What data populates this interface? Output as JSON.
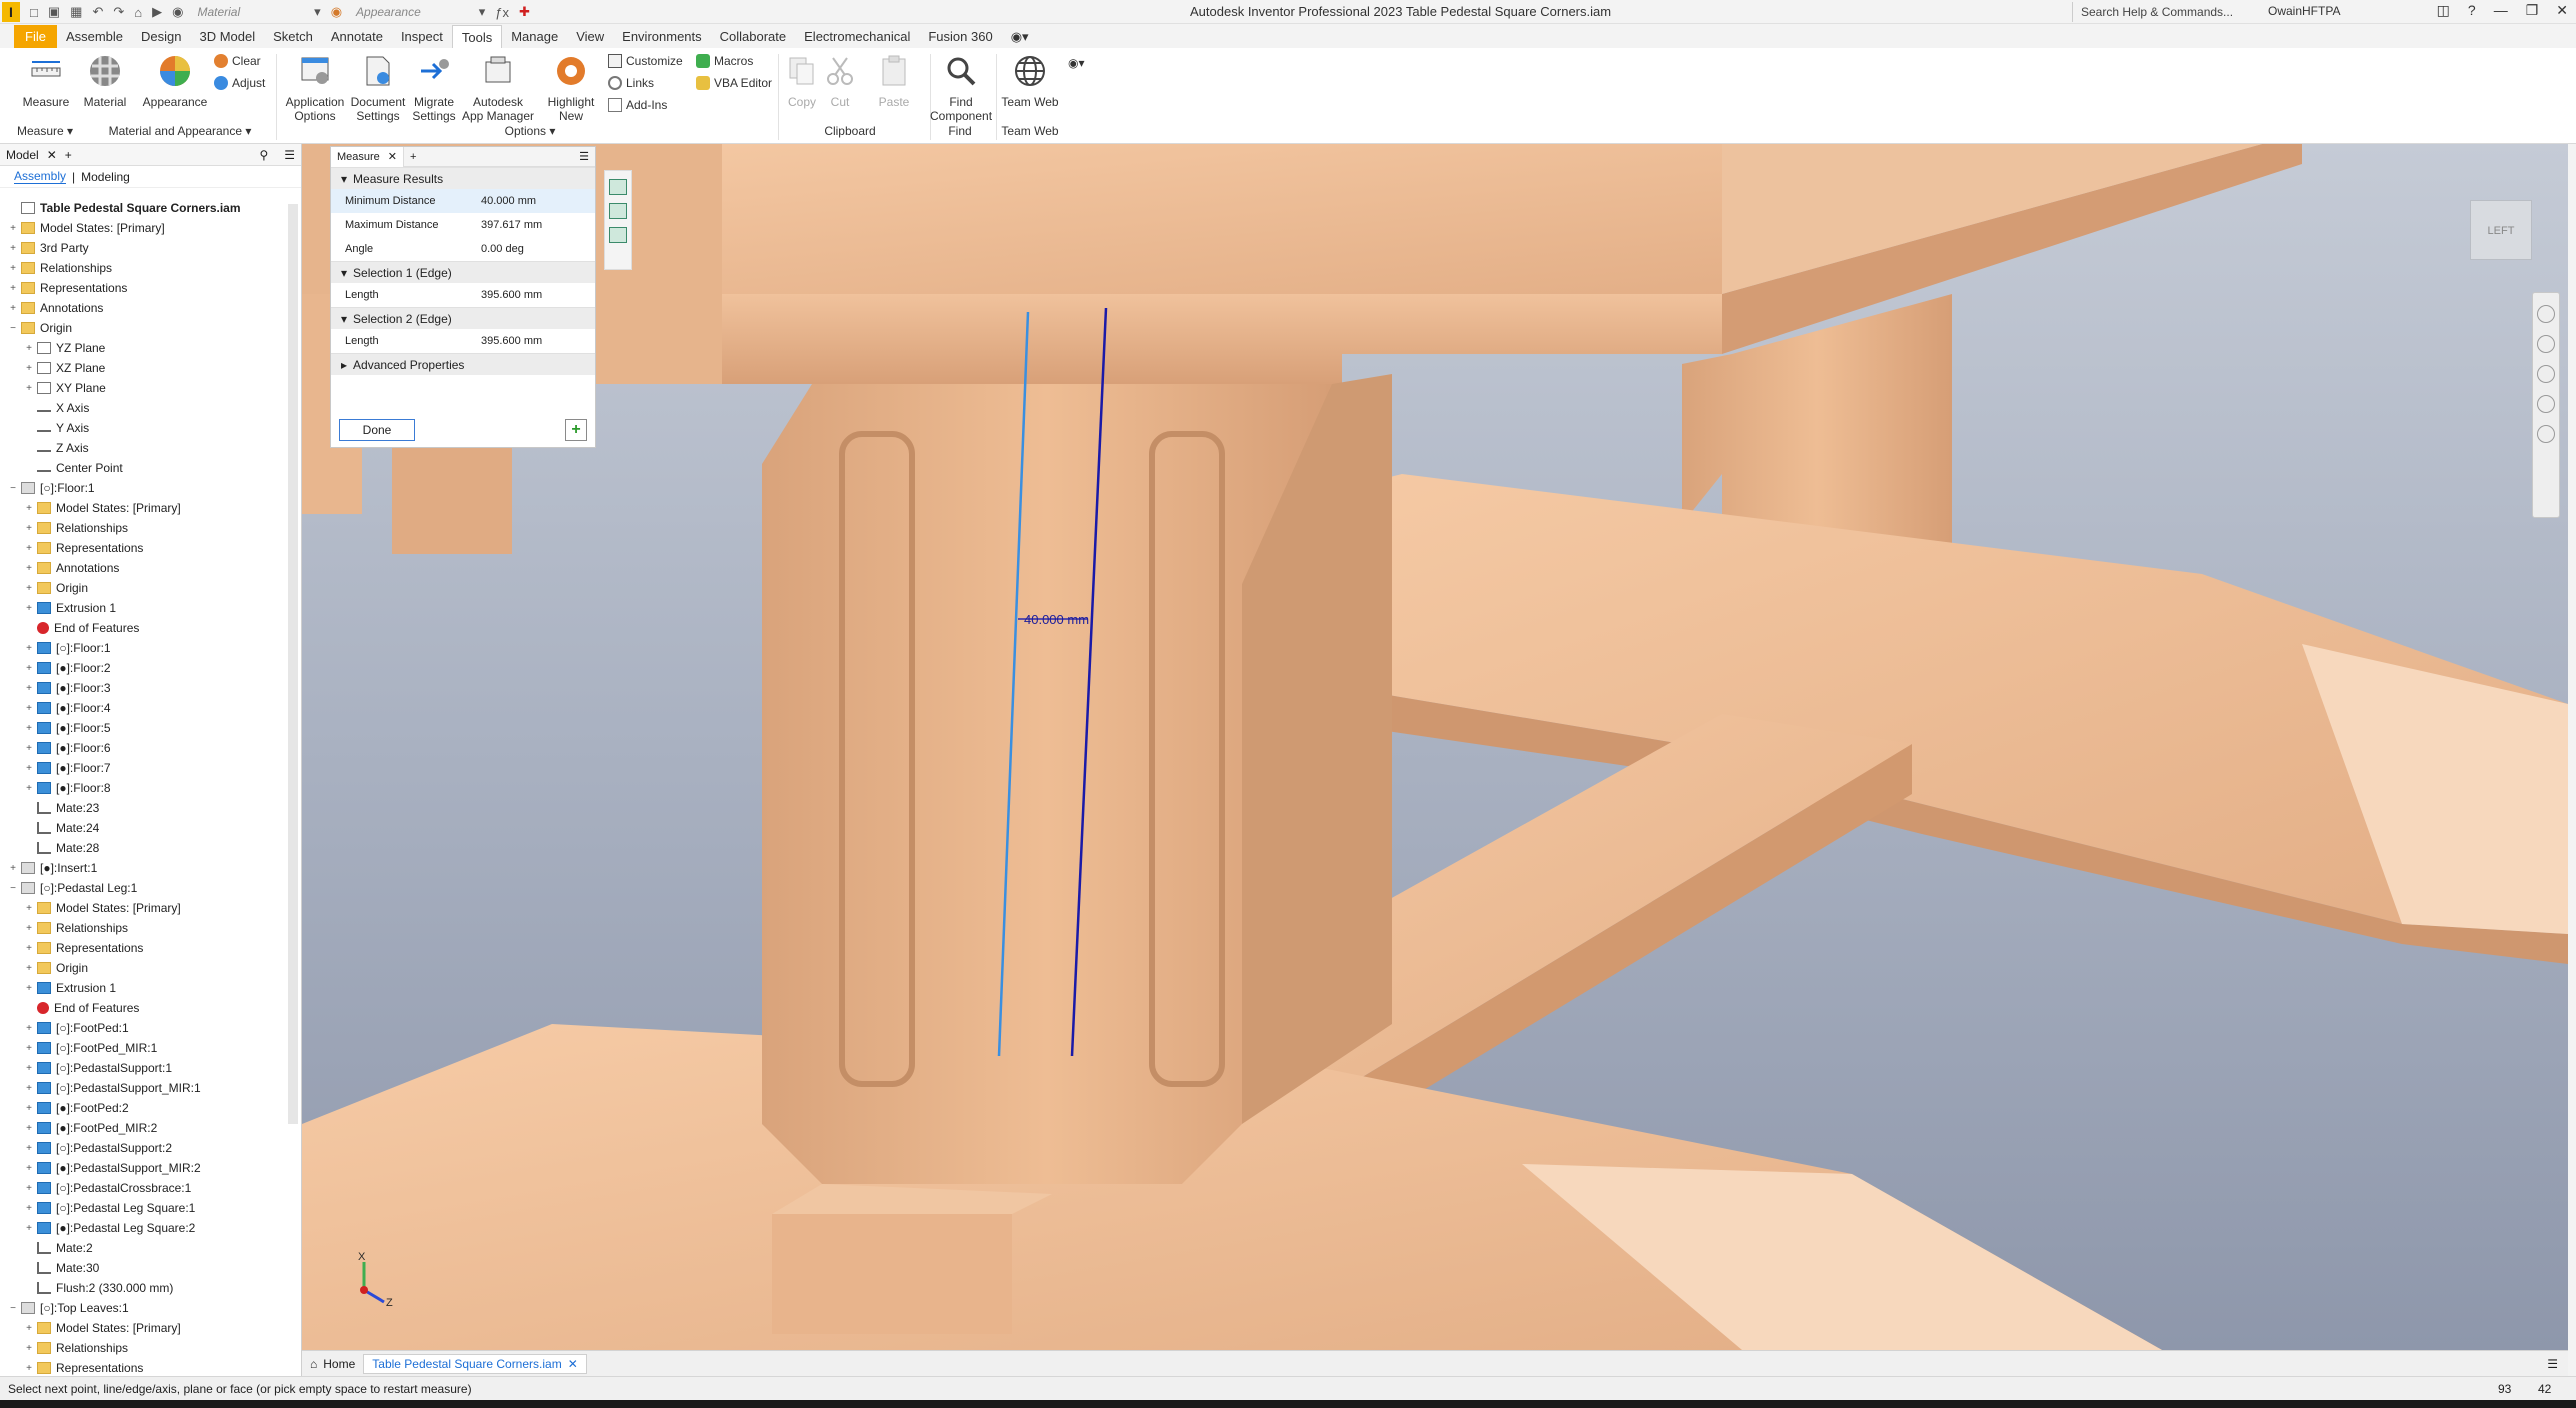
{
  "window": {
    "title": "Autodesk Inventor Professional 2023   Table Pedestal Square Corners.iam",
    "search_placeholder": "Search Help & Commands...",
    "user": "OwainHFTPA",
    "qat_material": "Material",
    "qat_appearance": "Appearance"
  },
  "menu_tabs": [
    "File",
    "Assemble",
    "Design",
    "3D Model",
    "Sketch",
    "Annotate",
    "Inspect",
    "Tools",
    "Manage",
    "View",
    "Environments",
    "Collaborate",
    "Electromechanical",
    "Fusion 360"
  ],
  "ribbon": {
    "measure": "Measure",
    "material": "Material",
    "appearance": "Appearance",
    "clear": "Clear",
    "adjust": "Adjust",
    "application_options": [
      "Application",
      "Options"
    ],
    "document_settings": [
      "Document",
      "Settings"
    ],
    "migrate_settings": [
      "Migrate",
      "Settings"
    ],
    "app_manager": [
      "Autodesk",
      "App Manager"
    ],
    "highlight_new": [
      "Highlight",
      "New"
    ],
    "customize": "Customize",
    "links": "Links",
    "add_ins": "Add-Ins",
    "macros": "Macros",
    "vba_editor": "VBA Editor",
    "copy": "Copy",
    "cut": "Cut",
    "paste": "Paste",
    "find_component": [
      "Find",
      "Component"
    ],
    "team_web": "Team Web",
    "panels": {
      "measure": "Measure ▾",
      "material_appearance": "Material and Appearance ▾",
      "options": "Options ▾",
      "clipboard": "Clipboard",
      "find": "Find",
      "team_web": "Team Web"
    }
  },
  "browser": {
    "tab": "Model",
    "sub_assembly": "Assembly",
    "sub_modeling": "Modeling",
    "nodes": [
      {
        "label": "Table Pedestal Square Corners.iam",
        "level": 0,
        "icon": "assembly",
        "exp": "",
        "root": true
      },
      {
        "label": "Model States: [Primary]",
        "level": 0,
        "icon": "folder",
        "exp": "+"
      },
      {
        "label": "3rd Party",
        "level": 0,
        "icon": "folder",
        "exp": "+"
      },
      {
        "label": "Relationships",
        "level": 0,
        "icon": "folder",
        "exp": "+"
      },
      {
        "label": "Representations",
        "level": 0,
        "icon": "folder",
        "exp": "+"
      },
      {
        "label": "Annotations",
        "level": 0,
        "icon": "folder",
        "exp": "+"
      },
      {
        "label": "Origin",
        "level": 0,
        "icon": "folder",
        "exp": "−"
      },
      {
        "label": "YZ Plane",
        "level": 1,
        "icon": "plane",
        "exp": "+"
      },
      {
        "label": "XZ Plane",
        "level": 1,
        "icon": "plane",
        "exp": "+"
      },
      {
        "label": "XY Plane",
        "level": 1,
        "icon": "plane",
        "exp": "+"
      },
      {
        "label": "X Axis",
        "level": 1,
        "icon": "axis",
        "exp": ""
      },
      {
        "label": "Y Axis",
        "level": 1,
        "icon": "axis",
        "exp": ""
      },
      {
        "label": "Z Axis",
        "level": 1,
        "icon": "axis",
        "exp": ""
      },
      {
        "label": "Center Point",
        "level": 1,
        "icon": "axis",
        "exp": ""
      },
      {
        "label": "[○]:Floor:1",
        "level": 0,
        "icon": "constr",
        "exp": "−"
      },
      {
        "label": "Model States: [Primary]",
        "level": 1,
        "icon": "folder",
        "exp": "+"
      },
      {
        "label": "Relationships",
        "level": 1,
        "icon": "folder",
        "exp": "+"
      },
      {
        "label": "Representations",
        "level": 1,
        "icon": "folder",
        "exp": "+"
      },
      {
        "label": "Annotations",
        "level": 1,
        "icon": "folder",
        "exp": "+"
      },
      {
        "label": "Origin",
        "level": 1,
        "icon": "folder",
        "exp": "+"
      },
      {
        "label": "Extrusion 1",
        "level": 1,
        "icon": "part",
        "exp": "+"
      },
      {
        "label": "End of Features",
        "level": 1,
        "icon": "err",
        "exp": ""
      },
      {
        "label": "[○]:Floor:1",
        "level": 1,
        "icon": "part",
        "exp": "+"
      },
      {
        "label": "[●]:Floor:2",
        "level": 1,
        "icon": "part",
        "exp": "+"
      },
      {
        "label": "[●]:Floor:3",
        "level": 1,
        "icon": "part",
        "exp": "+"
      },
      {
        "label": "[●]:Floor:4",
        "level": 1,
        "icon": "part",
        "exp": "+"
      },
      {
        "label": "[●]:Floor:5",
        "level": 1,
        "icon": "part",
        "exp": "+"
      },
      {
        "label": "[●]:Floor:6",
        "level": 1,
        "icon": "part",
        "exp": "+"
      },
      {
        "label": "[●]:Floor:7",
        "level": 1,
        "icon": "part",
        "exp": "+"
      },
      {
        "label": "[●]:Floor:8",
        "level": 1,
        "icon": "part",
        "exp": "+"
      },
      {
        "label": "Mate:23",
        "level": 1,
        "icon": "mate",
        "exp": ""
      },
      {
        "label": "Mate:24",
        "level": 1,
        "icon": "mate",
        "exp": ""
      },
      {
        "label": "Mate:28",
        "level": 1,
        "icon": "mate",
        "exp": ""
      },
      {
        "label": "[●]:Insert:1",
        "level": 0,
        "icon": "constr",
        "exp": "+"
      },
      {
        "label": "[○]:Pedastal Leg:1",
        "level": 0,
        "icon": "constr",
        "exp": "−"
      },
      {
        "label": "Model States: [Primary]",
        "level": 1,
        "icon": "folder",
        "exp": "+"
      },
      {
        "label": "Relationships",
        "level": 1,
        "icon": "folder",
        "exp": "+"
      },
      {
        "label": "Representations",
        "level": 1,
        "icon": "folder",
        "exp": "+"
      },
      {
        "label": "Origin",
        "level": 1,
        "icon": "folder",
        "exp": "+"
      },
      {
        "label": "Extrusion 1",
        "level": 1,
        "icon": "part",
        "exp": "+"
      },
      {
        "label": "End of Features",
        "level": 1,
        "icon": "err",
        "exp": ""
      },
      {
        "label": "[○]:FootPed:1",
        "level": 1,
        "icon": "part",
        "exp": "+"
      },
      {
        "label": "[○]:FootPed_MIR:1",
        "level": 1,
        "icon": "part",
        "exp": "+"
      },
      {
        "label": "[○]:PedastalSupport:1",
        "level": 1,
        "icon": "part",
        "exp": "+"
      },
      {
        "label": "[○]:PedastalSupport_MIR:1",
        "level": 1,
        "icon": "part",
        "exp": "+"
      },
      {
        "label": "[●]:FootPed:2",
        "level": 1,
        "icon": "part",
        "exp": "+"
      },
      {
        "label": "[●]:FootPed_MIR:2",
        "level": 1,
        "icon": "part",
        "exp": "+"
      },
      {
        "label": "[○]:PedastalSupport:2",
        "level": 1,
        "icon": "part",
        "exp": "+"
      },
      {
        "label": "[●]:PedastalSupport_MIR:2",
        "level": 1,
        "icon": "part",
        "exp": "+"
      },
      {
        "label": "[○]:PedastalCrossbrace:1",
        "level": 1,
        "icon": "part",
        "exp": "+"
      },
      {
        "label": "[○]:Pedastal Leg Square:1",
        "level": 1,
        "icon": "part",
        "exp": "+"
      },
      {
        "label": "[●]:Pedastal Leg Square:2",
        "level": 1,
        "icon": "part",
        "exp": "+"
      },
      {
        "label": "Mate:2",
        "level": 1,
        "icon": "mate",
        "exp": ""
      },
      {
        "label": "Mate:30",
        "level": 1,
        "icon": "mate",
        "exp": ""
      },
      {
        "label": "Flush:2 (330.000 mm)",
        "level": 1,
        "icon": "mate",
        "exp": ""
      },
      {
        "label": "[○]:Top Leaves:1",
        "level": 0,
        "icon": "constr",
        "exp": "−"
      },
      {
        "label": "Model States: [Primary]",
        "level": 1,
        "icon": "folder",
        "exp": "+"
      },
      {
        "label": "Relationships",
        "level": 1,
        "icon": "folder",
        "exp": "+"
      },
      {
        "label": "Representations",
        "level": 1,
        "icon": "folder",
        "exp": "+"
      }
    ]
  },
  "measure": {
    "tab": "Measure",
    "results_header": "Measure Results",
    "min_label": "Minimum Distance",
    "min_value": "40.000 mm",
    "max_label": "Maximum Distance",
    "max_value": "397.617 mm",
    "angle_label": "Angle",
    "angle_value": "0.00 deg",
    "sel1_header": "Selection 1 (Edge)",
    "sel1_label": "Length",
    "sel1_value": "395.600 mm",
    "sel2_header": "Selection 2 (Edge)",
    "sel2_label": "Length",
    "sel2_value": "395.600 mm",
    "advanced": "Advanced Properties",
    "done": "Done"
  },
  "viewport": {
    "dimension_label": "40.000 mm",
    "viewcube_label": "LEFT",
    "triad_x": "X",
    "triad_z": "Z"
  },
  "doc_tabs": {
    "home": "Home",
    "active": "Table Pedestal Square Corners.iam"
  },
  "status": {
    "message": "Select next point, line/edge/axis, plane or face (or pick empty space to restart measure)",
    "n1": "93",
    "n2": "42"
  },
  "colors": {
    "wood": "#e8b48b",
    "edge1": "#3a8fe0",
    "edge2": "#1a1aa8",
    "file_tab": "#f5a500"
  }
}
